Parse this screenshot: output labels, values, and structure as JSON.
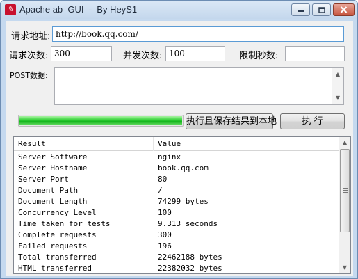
{
  "window": {
    "title": "Apache ab  GUI  -  By HeyS1",
    "app_icon": "feather-icon"
  },
  "form": {
    "url_label": "请求地址:",
    "url_value": "http://book.qq.com/",
    "requests_label": "请求次数:",
    "requests_value": "300",
    "concurrency_label": "并发次数:",
    "concurrency_value": "100",
    "timelimit_label": "限制秒数:",
    "timelimit_value": "",
    "post_label": "POST数据:",
    "post_value": ""
  },
  "progress": {
    "value": 1.0,
    "color": "#1fbe24"
  },
  "actions": {
    "run_save_label": "执行且保存结果到本地",
    "run_label": "执  行"
  },
  "results": {
    "columns": [
      "Result",
      "Value"
    ],
    "rows": [
      [
        "Server Software",
        "nginx"
      ],
      [
        "Server Hostname",
        "book.qq.com"
      ],
      [
        "Server Port",
        "80"
      ],
      [
        "Document Path",
        "/"
      ],
      [
        "Document Length",
        "74299 bytes"
      ],
      [
        "Concurrency Level",
        "100"
      ],
      [
        "Time taken for tests",
        "9.313 seconds"
      ],
      [
        "Complete requests",
        "300"
      ],
      [
        "Failed requests",
        "196"
      ],
      [
        "Total transferred",
        "22462188 bytes"
      ],
      [
        "HTML transferred",
        "22382032 bytes"
      ]
    ]
  }
}
